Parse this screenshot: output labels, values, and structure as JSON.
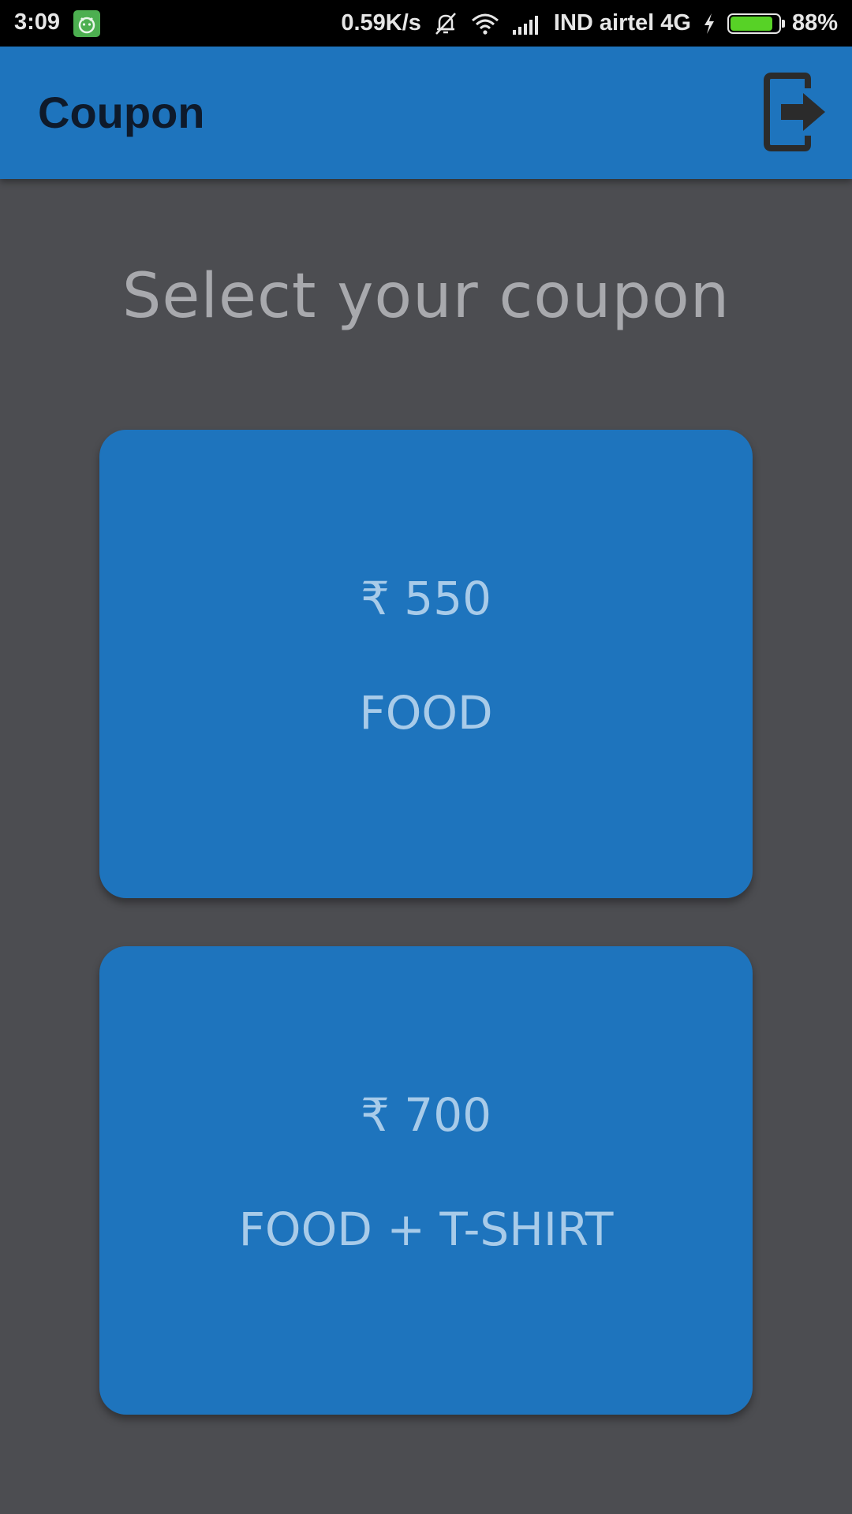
{
  "status_bar": {
    "time": "3:09",
    "net_speed": "0.59K/s",
    "carrier": "IND airtel 4G",
    "battery_percent": "88%",
    "battery_level": 0.88,
    "icons": [
      "app-notification-icon",
      "mute-icon",
      "wifi-icon",
      "signal-icon",
      "charging-icon",
      "battery-icon"
    ]
  },
  "app_bar": {
    "title": "Coupon",
    "logout_icon": "logout-icon"
  },
  "main": {
    "heading": "Select your coupon",
    "coupons": [
      {
        "price": "₹ 550",
        "label": "FOOD"
      },
      {
        "price": "₹ 700",
        "label": "FOOD + T-SHIRT"
      }
    ]
  },
  "colors": {
    "status_bar_bg": "#000000",
    "app_bar_bg": "#1e74bd",
    "page_bg": "#4c4d51",
    "heading_text": "#a8a9ad",
    "card_text": "#a8cbe9",
    "title_text": "#0e1a2b",
    "battery_fill": "#57d226"
  }
}
